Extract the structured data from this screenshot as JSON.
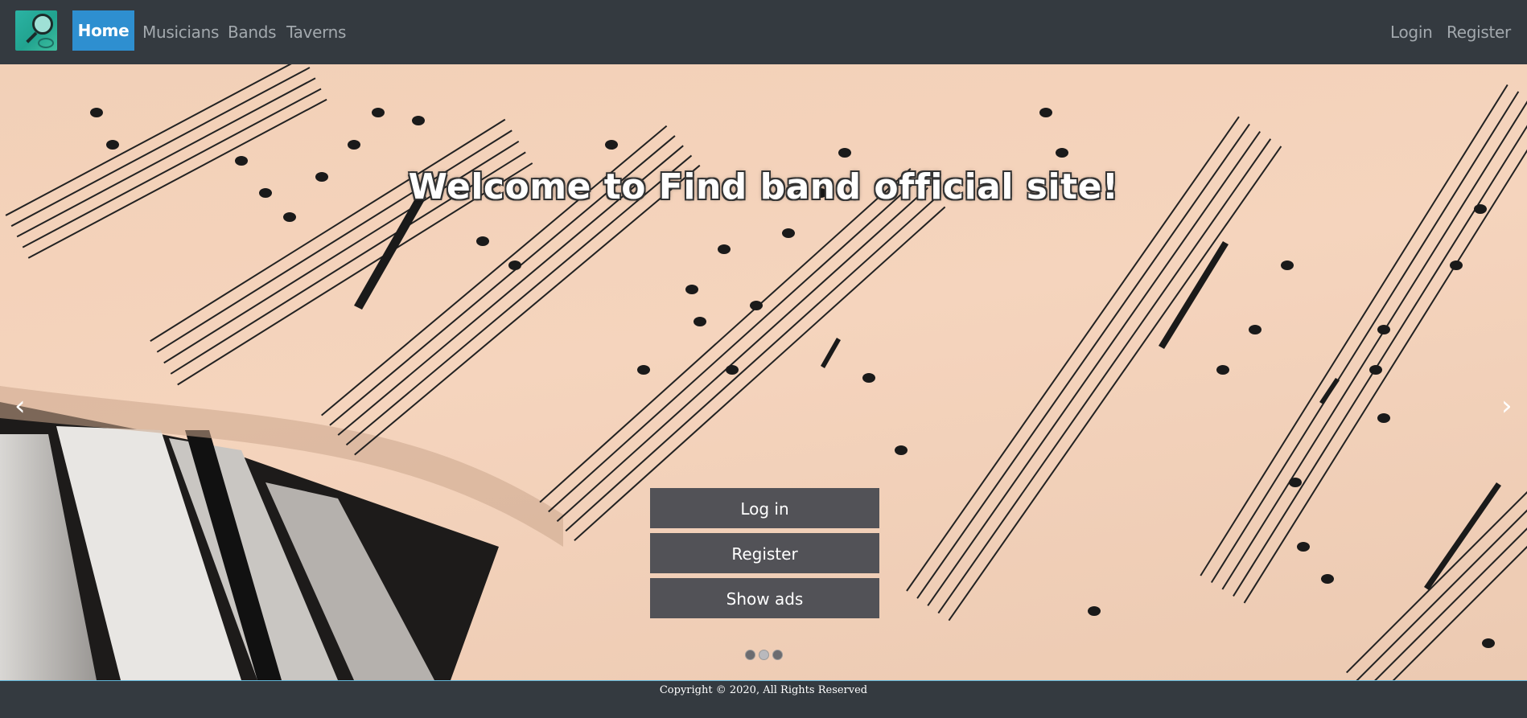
{
  "nav": {
    "home": "Home",
    "musicians": "Musicians",
    "bands": "Bands",
    "taverns": "Taverns",
    "login": "Login",
    "register": "Register"
  },
  "hero": {
    "title": "Welcome to Find band official site!",
    "buttons": {
      "login": "Log in",
      "register": "Register",
      "show_ads": "Show ads"
    },
    "prev": "‹",
    "next": "›",
    "slides_count": 3,
    "active_slide": 2
  },
  "footer": {
    "copyright": "Copyright © 2020, All Rights Reserved"
  }
}
